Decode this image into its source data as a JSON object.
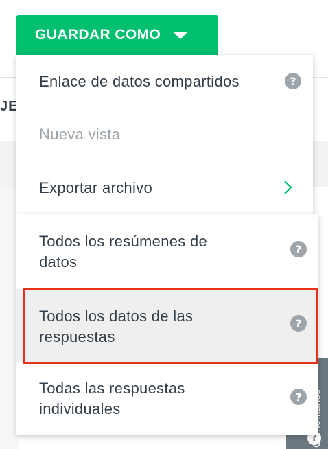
{
  "toolbar": {
    "save_as_label": "GUARDAR COMO",
    "accent_color": "#00bf6f"
  },
  "background": {
    "tab_text_fragment": "JES"
  },
  "menu": {
    "items": [
      {
        "label": "Enlace de datos compartidos",
        "icon": "help-icon",
        "enabled": true
      },
      {
        "label": "Nueva vista",
        "enabled": false
      },
      {
        "label": "Exportar archivo",
        "icon": "chevron-right-icon",
        "enabled": true
      }
    ]
  },
  "submenu": {
    "items": [
      {
        "line1": "Todos los resúmenes de",
        "line2": "datos",
        "icon": "help-icon"
      },
      {
        "line1": "Todos los datos de las",
        "line2": "respuestas",
        "icon": "help-icon",
        "highlighted": true
      },
      {
        "line1": "Todas las respuestas",
        "line2": "individuales",
        "icon": "help-icon"
      }
    ]
  },
  "help_glyph": "?",
  "feedback_tab": {
    "label": "Comentarios",
    "icon": "help-icon"
  },
  "highlight_color": "#e8321c"
}
